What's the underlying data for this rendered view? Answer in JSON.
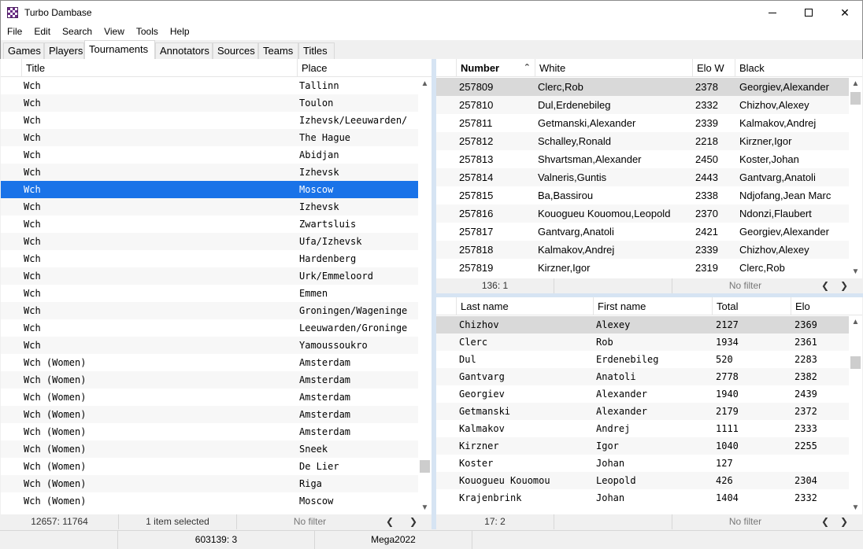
{
  "window": {
    "title": "Turbo Dambase"
  },
  "menu": [
    "File",
    "Edit",
    "Search",
    "View",
    "Tools",
    "Help"
  ],
  "tabs": [
    {
      "label": "Games",
      "active": false
    },
    {
      "label": "Players",
      "active": false
    },
    {
      "label": "Tournaments",
      "active": true
    },
    {
      "label": "Annotators",
      "active": false
    },
    {
      "label": "Sources",
      "active": false
    },
    {
      "label": "Teams",
      "active": false
    },
    {
      "label": "Titles",
      "active": false
    }
  ],
  "tournaments": {
    "columns": [
      "Title",
      "Place"
    ],
    "rows": [
      [
        "Wch",
        "Tallinn"
      ],
      [
        "Wch",
        "Toulon"
      ],
      [
        "Wch",
        "Izhevsk/Leeuwarden/"
      ],
      [
        "Wch",
        "The Hague"
      ],
      [
        "Wch",
        "Abidjan"
      ],
      [
        "Wch",
        "Izhevsk"
      ],
      [
        "Wch",
        "Moscow"
      ],
      [
        "Wch",
        "Izhevsk"
      ],
      [
        "Wch",
        "Zwartsluis"
      ],
      [
        "Wch",
        "Ufa/Izhevsk"
      ],
      [
        "Wch",
        "Hardenberg"
      ],
      [
        "Wch",
        "Urk/Emmeloord"
      ],
      [
        "Wch",
        "Emmen"
      ],
      [
        "Wch",
        "Groningen/Wageninge"
      ],
      [
        "Wch",
        "Leeuwarden/Groninge"
      ],
      [
        "Wch",
        "Yamoussoukro"
      ],
      [
        "Wch (Women)",
        "Amsterdam"
      ],
      [
        "Wch (Women)",
        "Amsterdam"
      ],
      [
        "Wch (Women)",
        "Amsterdam"
      ],
      [
        "Wch (Women)",
        "Amsterdam"
      ],
      [
        "Wch (Women)",
        "Amsterdam"
      ],
      [
        "Wch (Women)",
        "Sneek"
      ],
      [
        "Wch (Women)",
        "De Lier"
      ],
      [
        "Wch (Women)",
        "Riga"
      ],
      [
        "Wch (Women)",
        "Moscow"
      ]
    ],
    "selected_index": 6,
    "status": {
      "count": "12657: 11764",
      "selection": "1 item selected",
      "filter": "No filter"
    }
  },
  "games": {
    "columns": [
      "Number",
      "White",
      "Elo W",
      "Black"
    ],
    "rows": [
      [
        "257809",
        "Clerc,Rob",
        "2378",
        "Georgiev,Alexander"
      ],
      [
        "257810",
        "Dul,Erdenebileg",
        "2332",
        "Chizhov,Alexey"
      ],
      [
        "257811",
        "Getmanski,Alexander",
        "2339",
        "Kalmakov,Andrej"
      ],
      [
        "257812",
        "Schalley,Ronald",
        "2218",
        "Kirzner,Igor"
      ],
      [
        "257813",
        "Shvartsman,Alexander",
        "2450",
        "Koster,Johan"
      ],
      [
        "257814",
        "Valneris,Guntis",
        "2443",
        "Gantvarg,Anatoli"
      ],
      [
        "257815",
        "Ba,Bassirou",
        "2338",
        "Ndjofang,Jean Marc"
      ],
      [
        "257816",
        "Kouogueu Kouomou,Leopold",
        "2370",
        "Ndonzi,Flaubert"
      ],
      [
        "257817",
        "Gantvarg,Anatoli",
        "2421",
        "Georgiev,Alexander"
      ],
      [
        "257818",
        "Kalmakov,Andrej",
        "2339",
        "Chizhov,Alexey"
      ],
      [
        "257819",
        "Kirzner,Igor",
        "2319",
        "Clerc,Rob"
      ]
    ],
    "status": {
      "count": "136: 1",
      "filter": "No filter"
    }
  },
  "players": {
    "columns": [
      "Last name",
      "First name",
      "Total",
      "Elo"
    ],
    "rows": [
      [
        "Chizhov",
        "Alexey",
        "2127",
        "2369"
      ],
      [
        "Clerc",
        "Rob",
        "1934",
        "2361"
      ],
      [
        "Dul",
        "Erdenebileg",
        "520",
        "2283"
      ],
      [
        "Gantvarg",
        "Anatoli",
        "2778",
        "2382"
      ],
      [
        "Georgiev",
        "Alexander",
        "1940",
        "2439"
      ],
      [
        "Getmanski",
        "Alexander",
        "2179",
        "2372"
      ],
      [
        "Kalmakov",
        "Andrej",
        "1111",
        "2333"
      ],
      [
        "Kirzner",
        "Igor",
        "1040",
        "2255"
      ],
      [
        "Koster",
        "Johan",
        "127",
        ""
      ],
      [
        "Kouogueu Kouomou",
        "Leopold",
        "426",
        "2304"
      ],
      [
        "Krajenbrink",
        "Johan",
        "1404",
        "2332"
      ]
    ],
    "status": {
      "count": "17: 2",
      "filter": "No filter"
    }
  },
  "bottom_status": {
    "games": "603139: 3",
    "database": "Mega2022"
  }
}
